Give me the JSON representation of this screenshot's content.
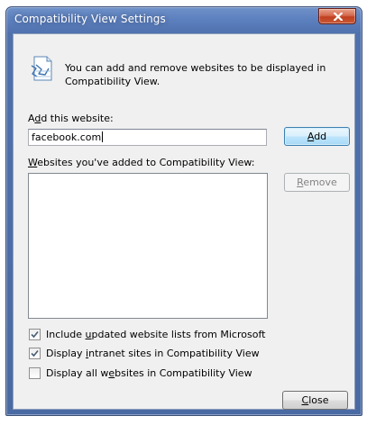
{
  "window": {
    "title": "Compatibility View Settings"
  },
  "info": {
    "icon": "compatibility-view-icon",
    "text": "You can add and remove websites to be displayed in Compatibility View."
  },
  "add_website": {
    "label_pre": "A",
    "label_mnemonic": "d",
    "label_post": "d this website:",
    "value": "facebook.com",
    "button_mnemonic": "A",
    "button_rest": "dd"
  },
  "websites_list": {
    "label_mnemonic": "W",
    "label_rest": "ebsites you've added to Compatibility View:",
    "items": [],
    "remove_mnemonic": "R",
    "remove_rest": "emove"
  },
  "options": [
    {
      "pre": "Include ",
      "mnemonic": "u",
      "post": "pdated website lists from Microsoft",
      "checked": true
    },
    {
      "pre": "Display ",
      "mnemonic": "i",
      "post": "ntranet sites in Compatibility View",
      "checked": true
    },
    {
      "pre": "Display all w",
      "mnemonic": "e",
      "post": "bsites in Compatibility View",
      "checked": false
    }
  ],
  "footer": {
    "close_mnemonic": "C",
    "close_rest": "lose"
  },
  "colors": {
    "title_bar": "#5c7fbe",
    "close_button": "#c0401f",
    "dialog_background": "#f0f0f0",
    "default_button_border": "#3c7fb1"
  }
}
